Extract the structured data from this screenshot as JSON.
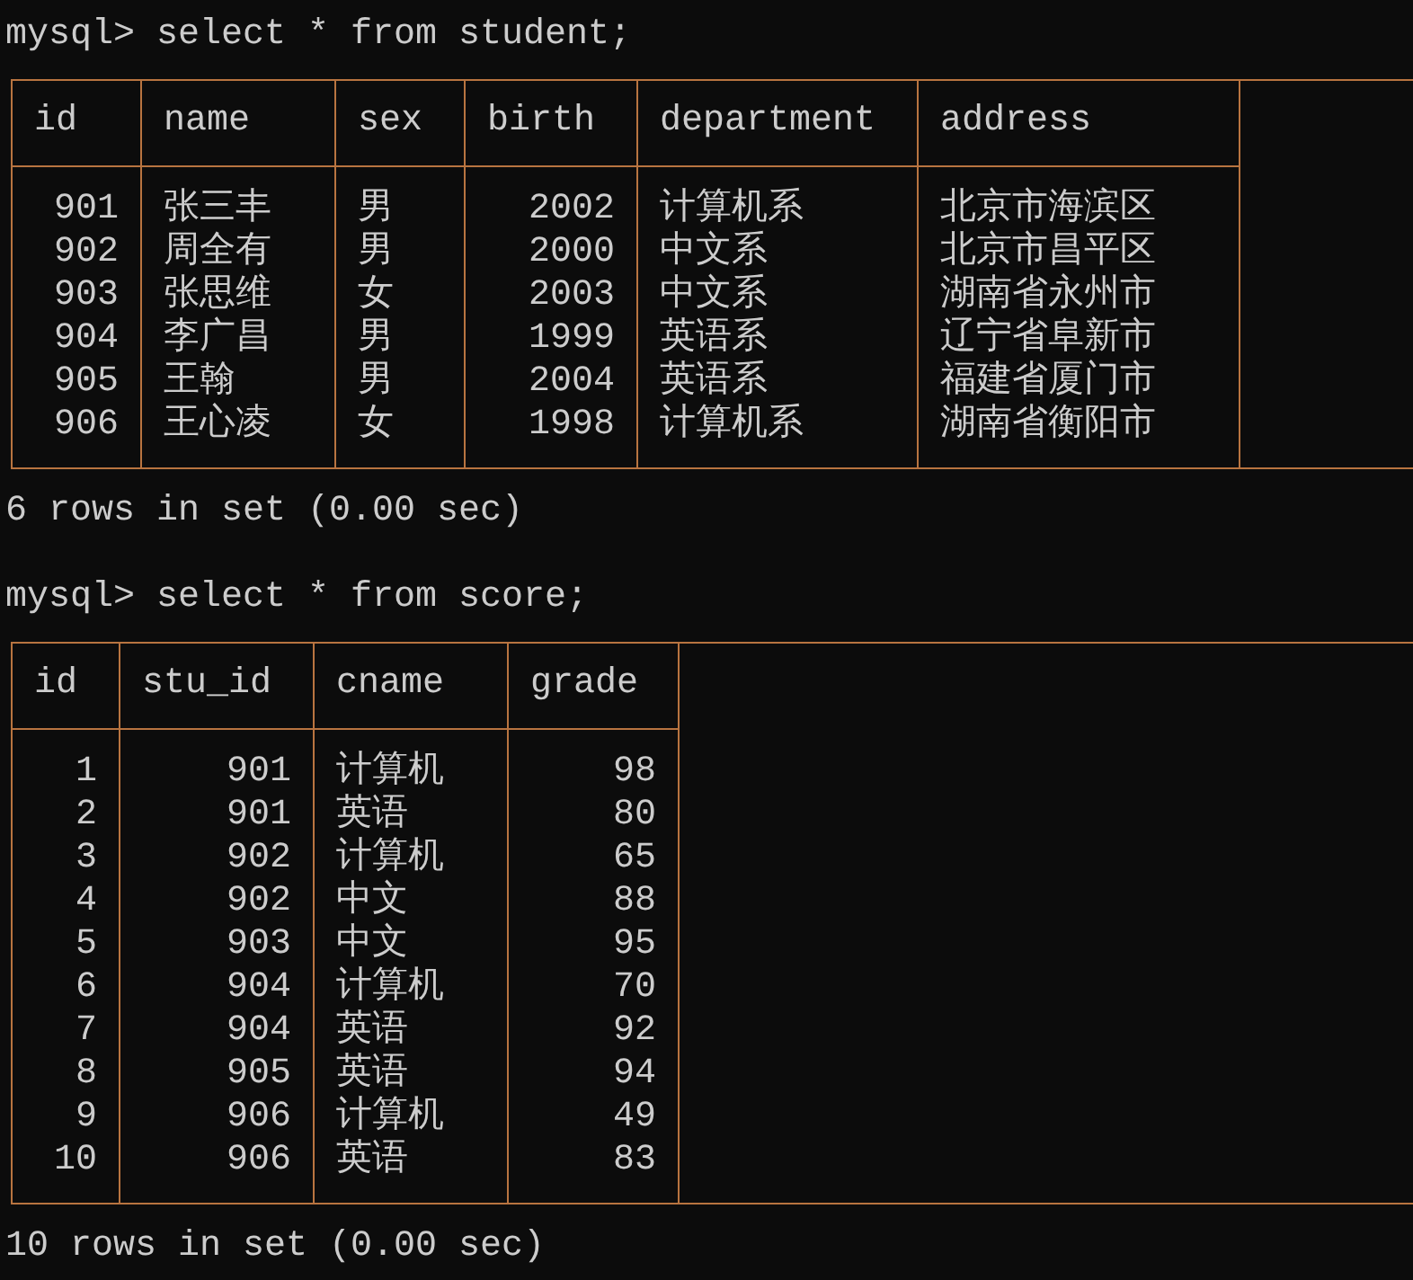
{
  "terminal": {
    "blocks": [
      {
        "command_line": "mysql> select * from student;",
        "table": {
          "columns": [
            {
              "name": "id"
            },
            {
              "name": "name"
            },
            {
              "name": "sex"
            },
            {
              "name": "birth"
            },
            {
              "name": "department"
            },
            {
              "name": "address"
            }
          ],
          "rows": [
            [
              "901",
              "张三丰",
              "男",
              "2002",
              "计算机系",
              "北京市海滨区"
            ],
            [
              "902",
              "周全有",
              "男",
              "2000",
              "中文系",
              "北京市昌平区"
            ],
            [
              "903",
              "张思维",
              "女",
              "2003",
              "中文系",
              "湖南省永州市"
            ],
            [
              "904",
              "李广昌",
              "男",
              "1999",
              "英语系",
              "辽宁省阜新市"
            ],
            [
              "905",
              "王翰",
              "男",
              "2004",
              "英语系",
              "福建省厦门市"
            ],
            [
              "906",
              "王心凌",
              "女",
              "1998",
              "计算机系",
              "湖南省衡阳市"
            ]
          ]
        },
        "result": "6 rows in set (0.00 sec)"
      },
      {
        "command_line": "mysql> select * from score;",
        "table": {
          "columns": [
            {
              "name": "id"
            },
            {
              "name": "stu_id"
            },
            {
              "name": "cname"
            },
            {
              "name": "grade"
            }
          ],
          "rows": [
            [
              "1",
              "901",
              "计算机",
              "98"
            ],
            [
              "2",
              "901",
              "英语",
              "80"
            ],
            [
              "3",
              "902",
              "计算机",
              "65"
            ],
            [
              "4",
              "902",
              "中文",
              "88"
            ],
            [
              "5",
              "903",
              "中文",
              "95"
            ],
            [
              "6",
              "904",
              "计算机",
              "70"
            ],
            [
              "7",
              "904",
              "英语",
              "92"
            ],
            [
              "8",
              "905",
              "英语",
              "94"
            ],
            [
              "9",
              "906",
              "计算机",
              "49"
            ],
            [
              "10",
              "906",
              "英语",
              "83"
            ]
          ]
        },
        "result": "10 rows in set (0.00 sec)"
      }
    ]
  }
}
